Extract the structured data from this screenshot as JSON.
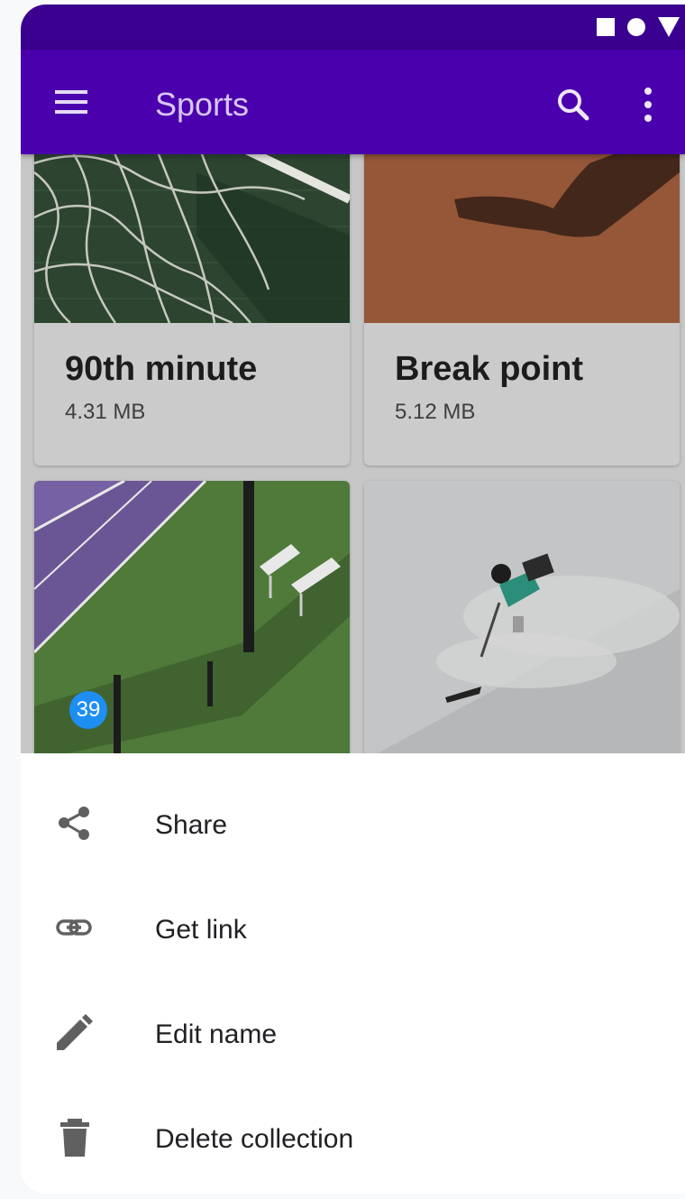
{
  "status_bar": {
    "icons": [
      "square-icon",
      "circle-icon",
      "triangle-icon"
    ]
  },
  "app_bar": {
    "title": "Sports",
    "icons": [
      "menu-icon",
      "search-icon",
      "more-vert-icon"
    ],
    "color": "#4a00ad"
  },
  "collections": [
    {
      "title": "90th minute",
      "size": "4.31 MB"
    },
    {
      "title": "Break point",
      "size": "5.12 MB"
    },
    {
      "title": "",
      "size": ""
    },
    {
      "title": "",
      "size": ""
    }
  ],
  "badge": {
    "count": "39",
    "color": "#1e8ef2"
  },
  "bottom_sheet": {
    "items": [
      {
        "label": "Share",
        "icon": "share-icon"
      },
      {
        "label": "Get link",
        "icon": "link-icon"
      },
      {
        "label": "Edit name",
        "icon": "pencil-icon"
      },
      {
        "label": "Delete collection",
        "icon": "trash-icon"
      }
    ]
  }
}
